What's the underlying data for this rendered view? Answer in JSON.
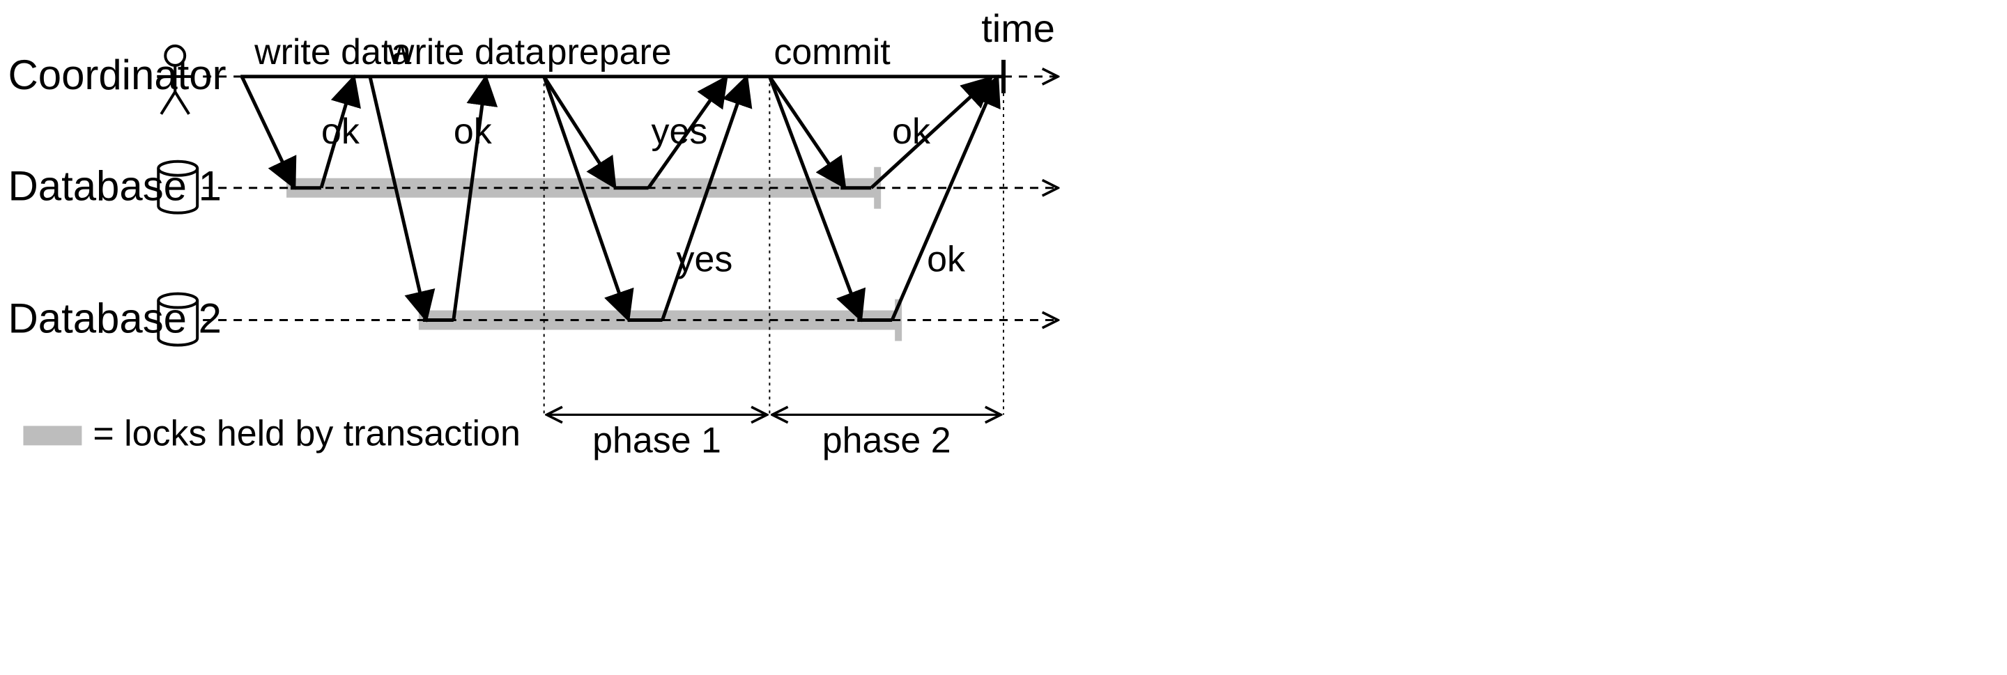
{
  "lanes": {
    "coordinator": "Coordinator",
    "db1": "Database 1",
    "db2": "Database 2"
  },
  "axis": {
    "time": "time"
  },
  "messages": {
    "write1": "write data",
    "write2": "write data",
    "prepare": "prepare",
    "commit": "commit",
    "ok1": "ok",
    "ok2": "ok",
    "yes1": "yes",
    "yes2": "yes",
    "ok3": "ok",
    "ok4": "ok"
  },
  "phases": {
    "p1": "phase 1",
    "p2": "phase 2"
  },
  "legend": {
    "locks": "= locks held by transaction"
  },
  "chart_data": {
    "type": "sequence-diagram",
    "participants": [
      "Coordinator",
      "Database 1",
      "Database 2"
    ],
    "lifelines_x_range": [
      165,
      1440
    ],
    "messages": [
      {
        "from": "Coordinator",
        "to": "Database 1",
        "label": "write data",
        "x": [
          173,
          210
        ]
      },
      {
        "from": "Database 1",
        "to": "Coordinator",
        "label": "ok",
        "x": [
          230,
          253
        ]
      },
      {
        "from": "Coordinator",
        "to": "Database 2",
        "label": "write data",
        "x": [
          265,
          305
        ]
      },
      {
        "from": "Database 2",
        "to": "Coordinator",
        "label": "ok",
        "x": [
          325,
          348
        ]
      },
      {
        "from": "Coordinator",
        "to": "Database 1",
        "label": "prepare",
        "x": [
          390,
          440
        ]
      },
      {
        "from": "Coordinator",
        "to": "Database 2",
        "label": "prepare",
        "x": [
          390,
          450
        ]
      },
      {
        "from": "Database 1",
        "to": "Coordinator",
        "label": "yes",
        "x": [
          465,
          520
        ]
      },
      {
        "from": "Database 2",
        "to": "Coordinator",
        "label": "yes",
        "x": [
          475,
          535
        ]
      },
      {
        "from": "Coordinator",
        "to": "Database 1",
        "label": "commit",
        "x": [
          552,
          605
        ]
      },
      {
        "from": "Coordinator",
        "to": "Database 2",
        "label": "commit",
        "x": [
          552,
          615
        ]
      },
      {
        "from": "Database 1",
        "to": "Coordinator",
        "label": "ok",
        "x": [
          625,
          710
        ]
      },
      {
        "from": "Database 2",
        "to": "Coordinator",
        "label": "ok",
        "x": [
          640,
          715
        ]
      }
    ],
    "locks_held": [
      {
        "participant": "Database 1",
        "x": [
          205,
          630
        ]
      },
      {
        "participant": "Database 2",
        "x": [
          300,
          645
        ]
      }
    ],
    "phases": [
      {
        "name": "phase 1",
        "x": [
          390,
          552
        ]
      },
      {
        "name": "phase 2",
        "x": [
          552,
          720
        ]
      }
    ]
  }
}
